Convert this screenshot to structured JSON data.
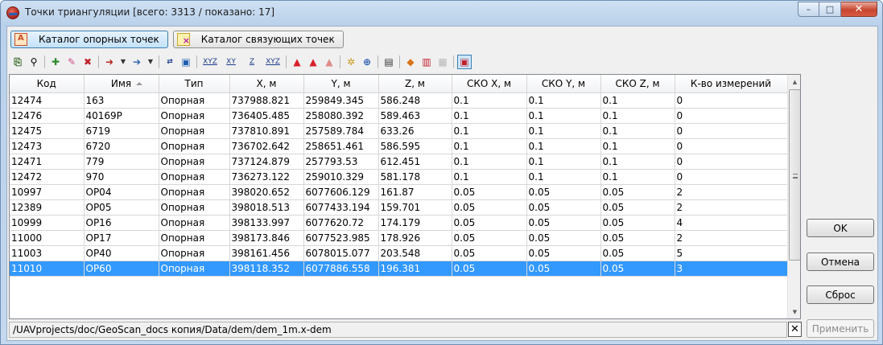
{
  "window": {
    "title": "Точки триангуляции [всего: 3313 / показано: 17]",
    "buttons": {
      "minimize": "–",
      "maximize": "□",
      "close": "✕"
    }
  },
  "tabs": [
    {
      "label": "Каталог опорных точек",
      "active": true
    },
    {
      "label": "Каталог связующих точек",
      "active": false
    }
  ],
  "toolbar": {
    "icons": [
      "import-icon",
      "find-icon",
      "add-point-icon",
      "edit-point-icon",
      "delete-point-icon",
      "move-icon",
      "export-icon",
      "swap-xy-icon",
      "measure-icon",
      "xyz-icon",
      "xy-icon",
      "z-icon",
      "xyz-all-icon",
      "mark-red-icon",
      "mark-red-a-icon",
      "mark-gray-icon",
      "settings-icon",
      "search-image-icon",
      "report-icon",
      "filter-icon",
      "stats-icon",
      "disabled-icon",
      "highlight-icon"
    ],
    "labels": {
      "xyz": "XYZ",
      "xy": "XY",
      "z": "Z",
      "xyz2": "XYZ"
    }
  },
  "table": {
    "columns": [
      "Код",
      "Имя",
      "Тип",
      "X, м",
      "Y, м",
      "Z, м",
      "СКО X, м",
      "СКО Y, м",
      "СКО Z, м",
      "К-во измерений"
    ],
    "rows": [
      [
        "12474",
        "163",
        "Опорная",
        "737988.821",
        "259849.345",
        "586.248",
        "0.1",
        "0.1",
        "0.1",
        "0"
      ],
      [
        "12476",
        "40169P",
        "Опорная",
        "736405.485",
        "258080.392",
        "589.463",
        "0.1",
        "0.1",
        "0.1",
        "0"
      ],
      [
        "12475",
        "6719",
        "Опорная",
        "737810.891",
        "257589.784",
        "633.26",
        "0.1",
        "0.1",
        "0.1",
        "0"
      ],
      [
        "12473",
        "6720",
        "Опорная",
        "736702.642",
        "258651.461",
        "586.595",
        "0.1",
        "0.1",
        "0.1",
        "0"
      ],
      [
        "12471",
        "779",
        "Опорная",
        "737124.879",
        "257793.53",
        "612.451",
        "0.1",
        "0.1",
        "0.1",
        "0"
      ],
      [
        "12472",
        "970",
        "Опорная",
        "736273.122",
        "259010.329",
        "581.178",
        "0.1",
        "0.1",
        "0.1",
        "0"
      ],
      [
        "10997",
        "OP04",
        "Опорная",
        "398020.652",
        "6077606.129",
        "161.87",
        "0.05",
        "0.05",
        "0.05",
        "2"
      ],
      [
        "12389",
        "OP05",
        "Опорная",
        "398018.513",
        "6077433.194",
        "159.701",
        "0.05",
        "0.05",
        "0.05",
        "2"
      ],
      [
        "10999",
        "OP16",
        "Опорная",
        "398133.997",
        "6077620.72",
        "174.179",
        "0.05",
        "0.05",
        "0.05",
        "4"
      ],
      [
        "11000",
        "OP17",
        "Опорная",
        "398173.846",
        "6077523.985",
        "178.926",
        "0.05",
        "0.05",
        "0.05",
        "2"
      ],
      [
        "11003",
        "OP40",
        "Опорная",
        "398161.456",
        "6078015.077",
        "203.548",
        "0.05",
        "0.05",
        "0.05",
        "5"
      ],
      [
        "11010",
        "OP60",
        "Опорная",
        "398118.352",
        "6077886.558",
        "196.381",
        "0.05",
        "0.05",
        "0.05",
        "3"
      ]
    ],
    "selected_row": 11
  },
  "status": {
    "path": "/UAVprojects/doc/GeoScan_docs копия/Data/dem/dem_1m.x-dem",
    "close": "✕"
  },
  "buttons": {
    "ok": "OK",
    "cancel": "Отмена",
    "reset": "Сброс",
    "apply": "Применить"
  },
  "colors": {
    "selection": "#3399ff",
    "active_tab": "#c4e2fb",
    "close_button": "#c8452f"
  }
}
